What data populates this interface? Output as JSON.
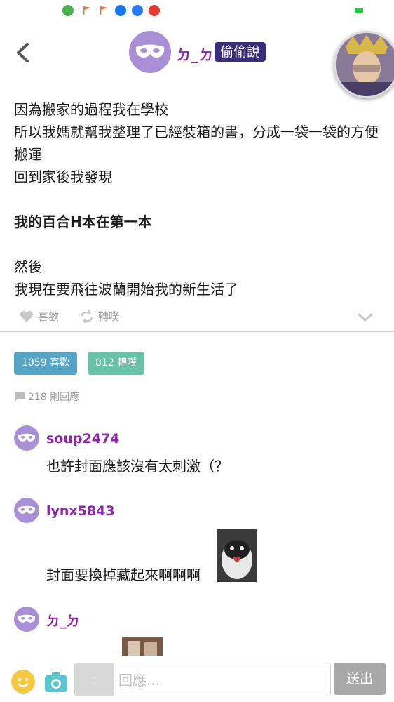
{
  "colors": {
    "accent_purple": "#8e24aa",
    "badge_dark": "#3a2d7a",
    "likes_blue": "#56a5c7",
    "shares_green": "#66c3a5"
  },
  "post": {
    "author": "ㄉ_ㄉ",
    "category": "偷偷說",
    "lines": [
      "因為搬家的過程我在學校",
      "所以我媽就幫我整理了已經裝箱的書，分成一袋一袋的方便搬運",
      "回到家後我發現",
      "我的百合H本在第一本",
      "然後",
      "我現在要飛往波蘭開始我的新生活了"
    ]
  },
  "actions": {
    "like_label": "喜歡",
    "share_label": "轉噗"
  },
  "stats": {
    "likes_badge": "1059 喜歡",
    "shares_badge": "812 轉噗",
    "reply_count": "218 則回應"
  },
  "comments": [
    {
      "user": "soup2474",
      "text": "也許封面應該沒有太刺激（？"
    },
    {
      "user": "lynx5843",
      "text": "封面要換掉藏起來啊啊啊"
    },
    {
      "user": "ㄉ_ㄉ",
      "text": ""
    }
  ],
  "reply_bar": {
    "prefix": ":",
    "placeholder": "回應...",
    "send_label": "送出"
  },
  "icons": [
    "back-chevron-icon",
    "mask-icon",
    "heart-icon",
    "retweet-icon",
    "chevron-down-icon",
    "speech-bubble-icon",
    "emoji-icon",
    "camera-icon"
  ]
}
